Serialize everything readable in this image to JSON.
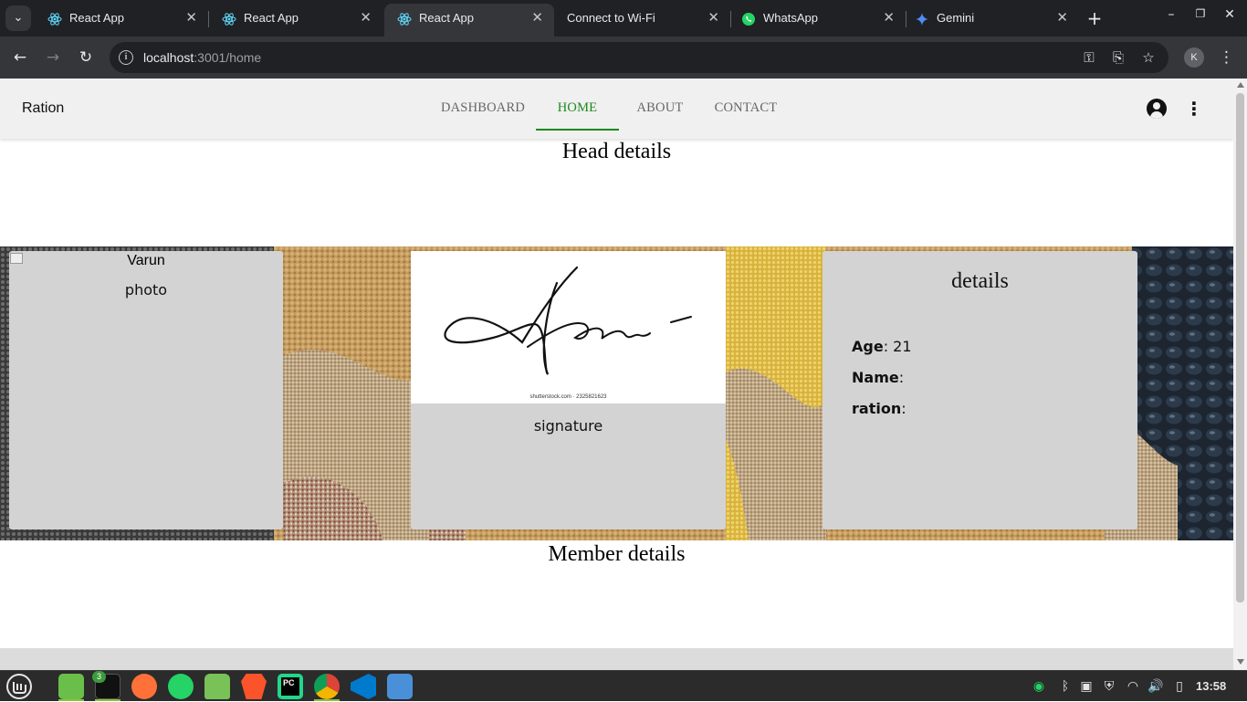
{
  "browser": {
    "tabs": [
      {
        "title": "React App",
        "icon": "react-icon",
        "active": false
      },
      {
        "title": "React App",
        "icon": "react-icon",
        "active": false
      },
      {
        "title": "React App",
        "icon": "react-icon",
        "active": true
      },
      {
        "title": "Connect to Wi-Fi",
        "icon": "none",
        "active": false
      },
      {
        "title": "WhatsApp",
        "icon": "whatsapp-icon",
        "active": false
      },
      {
        "title": "Gemini",
        "icon": "gemini-icon",
        "active": false
      }
    ],
    "url_host": "localhost",
    "url_path": ":3001/home",
    "profile_initial": "K"
  },
  "app": {
    "brand": "Ration",
    "nav": [
      {
        "label": "DASHBOARD",
        "active": false
      },
      {
        "label": "HOME",
        "active": true
      },
      {
        "label": "ABOUT",
        "active": false
      },
      {
        "label": "CONTACT",
        "active": false
      }
    ],
    "accent_color": "#1b8a1b"
  },
  "page": {
    "head_title": "Head details",
    "member_title": "Member details",
    "photo_alt": "Varun",
    "photo_caption": "photo",
    "signature_caption": "signature",
    "signature_credit": "shutterstock.com · 2325821623",
    "details_title": "details",
    "fields": [
      {
        "label": "Age",
        "value": "21"
      },
      {
        "label": "Name",
        "value": ""
      },
      {
        "label": "ration",
        "value": ""
      }
    ]
  },
  "taskbar": {
    "badge_count": "3",
    "clock": "13:58"
  }
}
